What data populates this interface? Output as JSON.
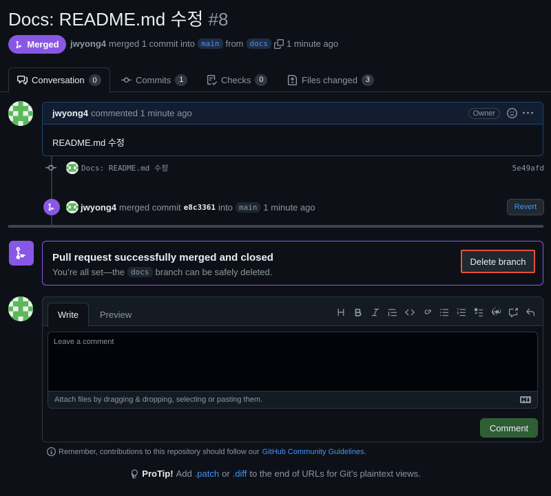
{
  "header": {
    "title": "Docs: README.md 수정",
    "number": "#8"
  },
  "meta": {
    "status": "Merged",
    "author": "jwyong4",
    "text_merged": "merged 1 commit into",
    "base_branch": "main",
    "text_from": "from",
    "head_branch": "docs",
    "time": "1 minute ago"
  },
  "tabs": [
    {
      "label": "Conversation",
      "count": "0"
    },
    {
      "label": "Commits",
      "count": "1"
    },
    {
      "label": "Checks",
      "count": "0"
    },
    {
      "label": "Files changed",
      "count": "3"
    }
  ],
  "comment": {
    "author": "jwyong4",
    "action": "commented 1 minute ago",
    "role": "Owner",
    "body": "README.md 수정"
  },
  "commit": {
    "message": "Docs: README.md 수정",
    "sha": "5e49afd"
  },
  "merge_event": {
    "author": "jwyong4",
    "text_commit": "merged commit",
    "sha": "e8c3361",
    "text_into": "into",
    "branch": "main",
    "time": "1 minute ago",
    "revert_label": "Revert"
  },
  "merged_box": {
    "title": "Pull request successfully merged and closed",
    "sub_before": "You’re all set—the",
    "branch": "docs",
    "sub_after": "branch can be safely deleted.",
    "delete_label": "Delete branch"
  },
  "editor": {
    "tab_write": "Write",
    "tab_preview": "Preview",
    "placeholder": "Leave a comment",
    "attach_text": "Attach files by dragging & dropping, selecting or pasting them.",
    "submit_label": "Comment"
  },
  "footer": {
    "guidelines_text": "Remember, contributions to this repository should follow our",
    "guidelines_link": "GitHub Community Guidelines",
    "guidelines_end": ".",
    "protip_label": "ProTip!",
    "protip_add": "Add",
    "protip_patch": ".patch",
    "protip_or": "or",
    "protip_diff": ".diff",
    "protip_end": "to the end of URLs for Git’s plaintext views."
  },
  "colors": {
    "merged_purple": "#8957e5",
    "link_blue": "#4493f8",
    "highlight_red": "#e5533a"
  }
}
